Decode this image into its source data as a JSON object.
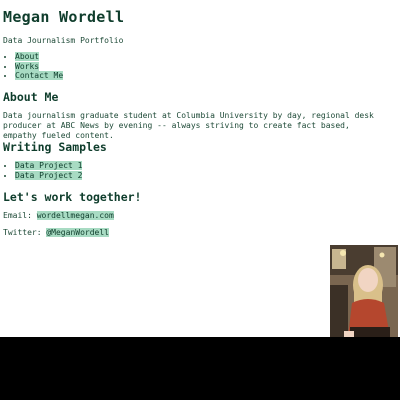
{
  "header": {
    "name": "Megan Wordell",
    "subtitle": "Data Journalism Portfolio"
  },
  "nav": {
    "items": [
      {
        "label": "About"
      },
      {
        "label": "Works"
      },
      {
        "label": "Contact Me"
      }
    ]
  },
  "about": {
    "heading": "About Me",
    "text": "Data journalism graduate student at Columbia University by day, regional desk producer at ABC News by evening -- always striving to create fact based, empathy fueled content."
  },
  "writing": {
    "heading": "Writing Samples",
    "items": [
      {
        "label": "Data Project 1"
      },
      {
        "label": "Data Project 2"
      }
    ]
  },
  "contact": {
    "heading": "Let's work together!",
    "email_label": "Email: ",
    "email": "wordellmegan.com",
    "twitter_label": "Twitter: ",
    "twitter": "@MeganWordell"
  },
  "theme": {
    "text_color": "#1e4a37",
    "highlight_color": "#a8dbc3",
    "background": "#ffffff"
  }
}
